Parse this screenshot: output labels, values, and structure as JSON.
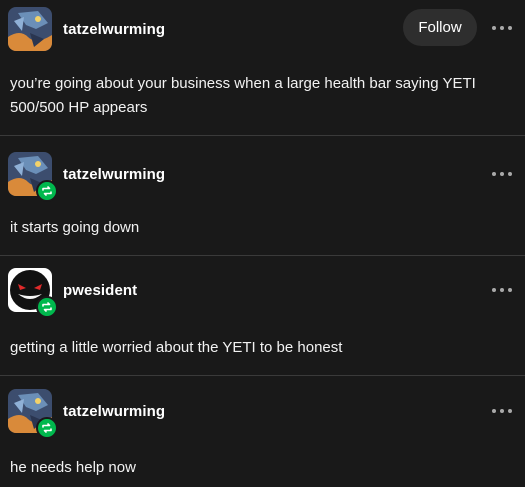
{
  "posts": [
    {
      "username": "tatzelwurming",
      "follow_label": "Follow",
      "text": "you’re going about your business when a large health bar saying YETI 500/500 HP appears",
      "avatar_icon": "dragon-avatar",
      "reblogged": false
    },
    {
      "username": "tatzelwurming",
      "text": "it starts going down",
      "avatar_icon": "dragon-avatar",
      "reblogged": true
    },
    {
      "username": "pwesident",
      "text": "getting a little worried about the YETI to be honest",
      "avatar_icon": "ghost-avatar",
      "reblogged": true
    },
    {
      "username": "tatzelwurming",
      "text": "he needs help now",
      "avatar_icon": "dragon-avatar",
      "reblogged": true
    }
  ],
  "icons": {
    "more": "more-options-icon",
    "reblog": "reblog-icon"
  },
  "colors": {
    "background": "#191919",
    "divider": "#3a3a3a",
    "reblog_badge": "#00b84d",
    "follow_button": "#2e2e2e",
    "text": "#ffffff"
  }
}
